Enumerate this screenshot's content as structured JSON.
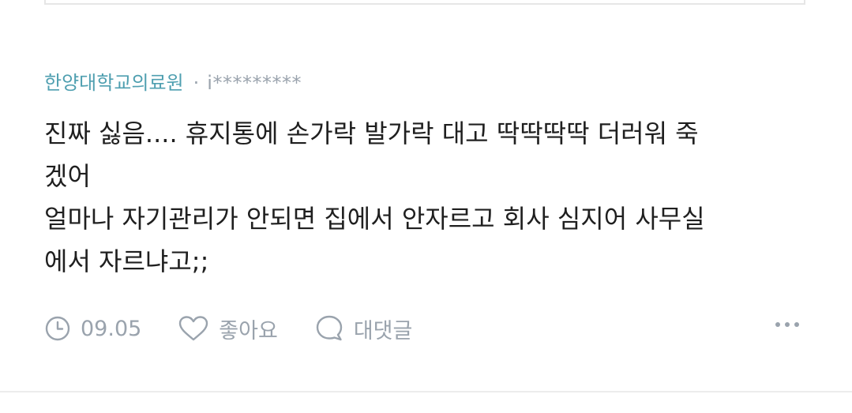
{
  "post": {
    "company": "한양대학교의료원",
    "separator": "·",
    "user_id": "i*********",
    "content": "진짜 싫음.... 휴지통에 손가락 발가락 대고 딱딱딱딱 더러워 죽\n겠어\n얼마나 자기관리가 안되면 집에서 안자르고 회사 심지어 사무실\n에서 자르냐고;;",
    "time": "09.05",
    "like_label": "좋아요",
    "comment_label": "대댓글"
  },
  "icons": {
    "time": "clock-icon",
    "like": "heart-icon",
    "comment": "speech-bubble-icon",
    "more": "more-dots-icon"
  },
  "colors": {
    "company": "#4f9fb0",
    "muted": "#9aa3ad",
    "text": "#1f1f1f"
  }
}
